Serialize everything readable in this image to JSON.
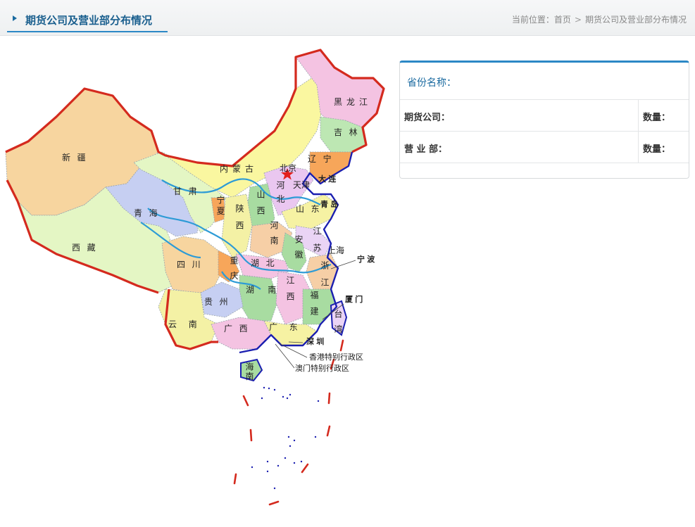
{
  "header": {
    "title": "期货公司及营业部分布情况",
    "breadcrumb_prefix": "当前位置：",
    "breadcrumb_home": "首页",
    "breadcrumb_separator": ">",
    "breadcrumb_current": "期货公司及营业部分布情况"
  },
  "map": {
    "provinces": {
      "xinjiang": "新疆",
      "xizang": "西藏",
      "qinghai": "青海",
      "gansu": "甘肃",
      "neimenggu": "内蒙古",
      "heilongjiang": "黑龙江",
      "jilin": "吉林",
      "liaoning": "辽宁",
      "beijing": "北京",
      "tianjin": "天津",
      "hebei": "河北",
      "shanxi": "山西",
      "shandong": "山东",
      "ningxia": "宁夏",
      "shaanxi": "陕西",
      "henan": "河南",
      "jiangsu": "江苏",
      "anhui": "安徽",
      "shanghai": "上海",
      "zhejiang": "浙江",
      "sichuan": "四川",
      "chongqing": "重庆",
      "hubei": "湖北",
      "hunan": "湖南",
      "jiangxi": "江西",
      "fujian": "福建",
      "taiwan": "台湾",
      "guizhou": "贵州",
      "yunnan": "云南",
      "guangxi": "广西",
      "guangdong": "广东",
      "hainan": "海南"
    },
    "cities": {
      "dalian": "大连",
      "qingdao": "青岛",
      "ningbo": "宁波",
      "xiamen": "厦门",
      "shenzhen": "深圳"
    },
    "regions": {
      "hongkong": "香港特别行政区",
      "macau": "澳门特别行政区"
    },
    "colors": {
      "border_red": "#d42a1e",
      "coast_blue": "#1b1fb0",
      "river_blue": "#2d9bd6",
      "capital_star": "#e3201c"
    }
  },
  "info_panel": {
    "province_label": "省份名称：",
    "province_value": "",
    "futures_label": "期货公司：",
    "futures_value": "",
    "futures_count_label": "数量：",
    "futures_count_value": "",
    "branch_label": "营 业 部：",
    "branch_value": "",
    "branch_count_label": "数量：",
    "branch_count_value": ""
  }
}
